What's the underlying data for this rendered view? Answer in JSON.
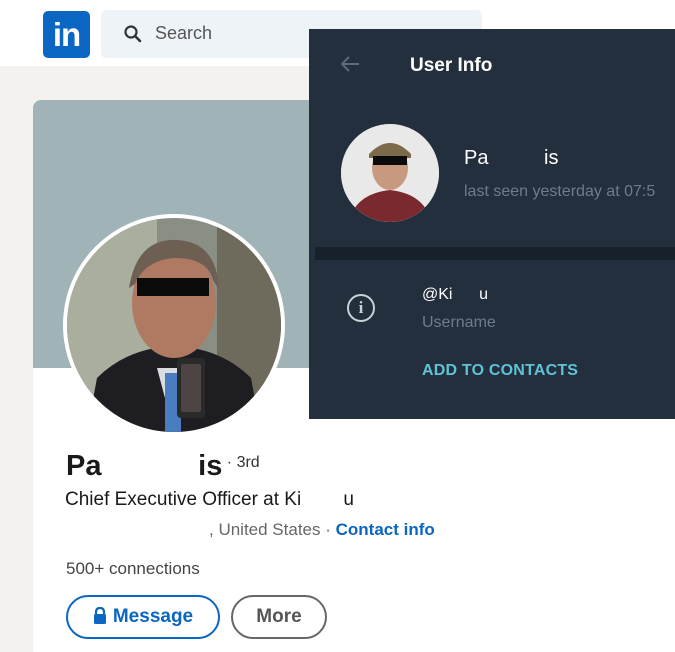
{
  "linkedin": {
    "search": {
      "placeholder": "Search"
    },
    "profile": {
      "name": "Pa            is",
      "degree": "· 3rd",
      "headline": "Chief Executive Officer at Ki        u",
      "location": ", United States · ",
      "contact_info": "Contact info",
      "connections": "500+ connections",
      "message_label": "Message",
      "more_label": "More"
    }
  },
  "telegram": {
    "title": "User Info",
    "name": "Pa          is",
    "last_seen": "last seen yesterday at 07:5",
    "username": "@Ki      u",
    "username_label": "Username",
    "add_contacts_label": "ADD TO CONTACTS"
  },
  "colors": {
    "linkedin_blue": "#0a66c2",
    "telegram_bg": "#242f3d",
    "telegram_accent": "#5fc2d6"
  },
  "icons": [
    "linkedin-logo",
    "search-icon",
    "lock-icon",
    "back-arrow-icon",
    "info-icon"
  ]
}
